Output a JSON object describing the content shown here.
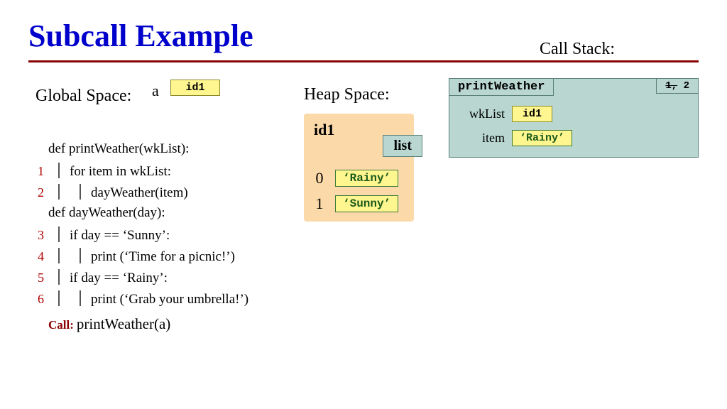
{
  "title": "Subcall Example",
  "labels": {
    "call_stack": "Call Stack:",
    "global_space": "Global Space:",
    "heap_space": "Heap Space:"
  },
  "global": {
    "var_a_name": "a",
    "var_a_value": "id1"
  },
  "code": {
    "def_print": "def printWeather(wkList):",
    "l1": "for item in wkList:",
    "l2": "dayWeather(item)",
    "def_day": "def dayWeather(day):",
    "l3": "if day == ‘Sunny’:",
    "l4": "print (‘Time for a picnic!’)",
    "l5": "if day == ‘Rainy’:",
    "l6": "print (‘Grab your umbrella!’)",
    "call_prefix": "Call:",
    "call_expr": "printWeather(a)",
    "nums": {
      "n1": "1",
      "n2": "2",
      "n3": "3",
      "n4": "4",
      "n5": "5",
      "n6": "6"
    }
  },
  "heap": {
    "obj_id": "id1",
    "type": "list",
    "rows": [
      {
        "idx": "0",
        "val": "‘Rainy’"
      },
      {
        "idx": "1",
        "val": "‘Sunny’"
      }
    ]
  },
  "stack": {
    "frame_name": "printWeather",
    "pc_struck": "1,",
    "pc_current": " 2",
    "vars": [
      {
        "name": "wkList",
        "val": "id1"
      },
      {
        "name": "item",
        "val": "‘Rainy’"
      }
    ]
  }
}
